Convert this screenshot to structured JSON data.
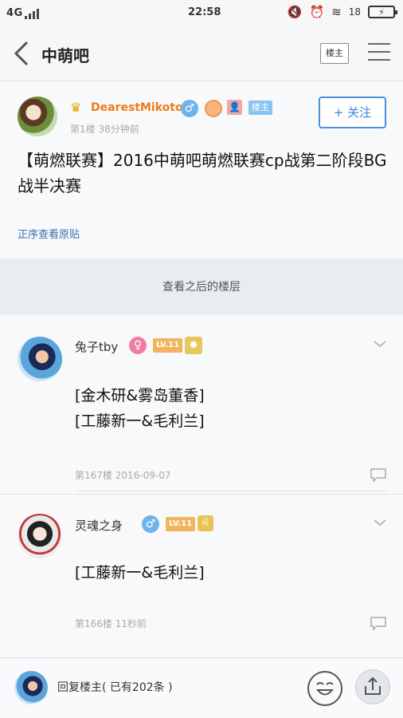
{
  "status_bar": {
    "network": "4G",
    "time": "22:58",
    "battery_percent": "18",
    "battery_label": "",
    "icons": [
      "signal-bars-icon",
      "mute-icon",
      "alarm-icon",
      "wifi-icon",
      "battery-charging-icon"
    ]
  },
  "header": {
    "back_icon": "back-arrow-icon",
    "title": "中萌吧",
    "louzhu_button": "楼主",
    "menu_icon": "hamburger-menu-icon"
  },
  "first_post": {
    "username": "DearestMikoto",
    "louzhu_tag": "楼主",
    "floor_time": "第1楼   38分钟前",
    "follow_label": "+ 关注",
    "title": "【萌燃联赛】2016中萌吧萌燃联赛cp战第二阶段BG战半决赛",
    "view_original": "正序查看原贴"
  },
  "later_floors_label": "查看之后的楼层",
  "replies": [
    {
      "username": "兔子tby",
      "gender": "female",
      "level": "LV.11",
      "content_lines": [
        "[金木研&雾岛董香]",
        "[工藤新一&毛利兰]"
      ],
      "meta": "第167楼   2016-09-07"
    },
    {
      "username": "灵魂之身",
      "gender": "male",
      "level": "LV.11",
      "content_lines": [
        "[工藤新一&毛利兰]"
      ],
      "meta": "第166楼   11秒前"
    }
  ],
  "bottom_bar": {
    "reply_placeholder": "回复楼主( 已有202条 )",
    "emoji_icon": "emoji-face-icon",
    "share_icon": "share-icon"
  },
  "colors": {
    "accent_blue": "#3a86d8",
    "username_orange": "#f07a1a",
    "level_badge": "#f1b55f"
  }
}
